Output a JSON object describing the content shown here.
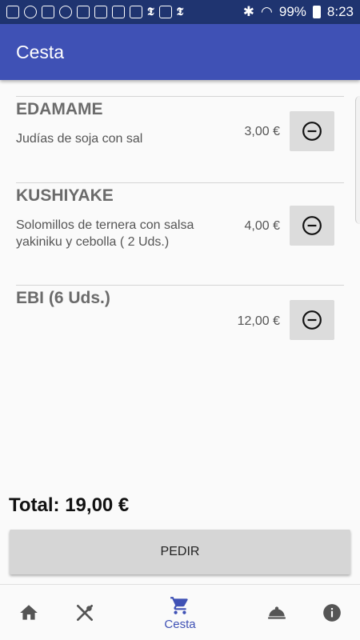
{
  "status": {
    "battery": "99%",
    "time": "8:23"
  },
  "appbar": {
    "title": "Cesta"
  },
  "items": [
    {
      "name": "EDAMAME",
      "desc": "Judías de soja con sal",
      "price": "3,00 €"
    },
    {
      "name": "KUSHIYAKE",
      "desc": "Solomillos de ternera con salsa yakiniku y cebolla ( 2 Uds.)",
      "price": "4,00 €"
    },
    {
      "name": "EBI (6 Uds.)",
      "desc": "",
      "price": "12,00 €"
    }
  ],
  "total": "Total: 19,00 €",
  "pedir_label": "PEDIR",
  "nav": {
    "cesta_label": "Cesta",
    "active_color": "#3f51b5",
    "inactive_color": "#555555"
  }
}
